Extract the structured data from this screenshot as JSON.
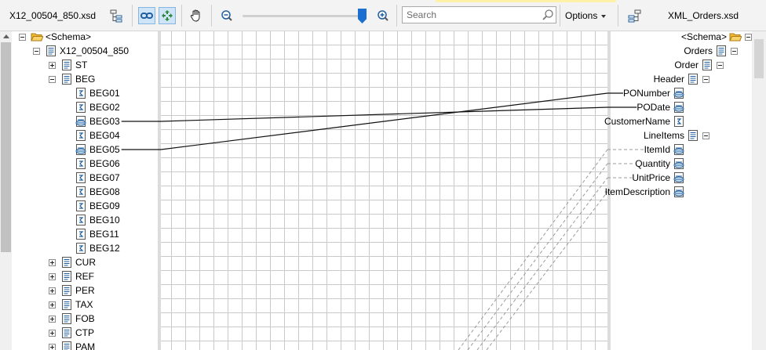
{
  "toolbar": {
    "source_schema_title": "X12_00504_850.xsd",
    "destination_schema_title": "XML_Orders.xsd",
    "search_placeholder": "Search",
    "options_label": "Options",
    "zoom_level": 0.95
  },
  "source_tree": [
    {
      "label": "<Schema>",
      "icon": "folder-open-icon",
      "depth": 0,
      "expander": "minus",
      "name": "source-schema-root"
    },
    {
      "label": "X12_00504_850",
      "icon": "document-icon",
      "depth": 1,
      "expander": "minus",
      "name": "source-record-x12-00504-850"
    },
    {
      "label": "ST",
      "icon": "document-icon",
      "depth": 2,
      "expander": "plus",
      "name": "source-record-st"
    },
    {
      "label": "BEG",
      "icon": "document-icon",
      "depth": 2,
      "expander": "minus",
      "name": "source-record-beg"
    },
    {
      "label": "BEG01",
      "icon": "field-icon",
      "depth": 3,
      "name": "source-field-beg01"
    },
    {
      "label": "BEG02",
      "icon": "field-icon",
      "depth": 3,
      "name": "source-field-beg02"
    },
    {
      "label": "BEG03",
      "icon": "linked-field-icon",
      "depth": 3,
      "name": "source-field-beg03",
      "linked": true
    },
    {
      "label": "BEG04",
      "icon": "field-icon",
      "depth": 3,
      "name": "source-field-beg04"
    },
    {
      "label": "BEG05",
      "icon": "linked-field-icon",
      "depth": 3,
      "name": "source-field-beg05",
      "linked": true
    },
    {
      "label": "BEG06",
      "icon": "field-icon",
      "depth": 3,
      "name": "source-field-beg06"
    },
    {
      "label": "BEG07",
      "icon": "field-icon",
      "depth": 3,
      "name": "source-field-beg07"
    },
    {
      "label": "BEG08",
      "icon": "field-icon",
      "depth": 3,
      "name": "source-field-beg08"
    },
    {
      "label": "BEG09",
      "icon": "field-icon",
      "depth": 3,
      "name": "source-field-beg09"
    },
    {
      "label": "BEG10",
      "icon": "field-icon",
      "depth": 3,
      "name": "source-field-beg10"
    },
    {
      "label": "BEG11",
      "icon": "field-icon",
      "depth": 3,
      "name": "source-field-beg11"
    },
    {
      "label": "BEG12",
      "icon": "field-icon",
      "depth": 3,
      "name": "source-field-beg12"
    },
    {
      "label": "CUR",
      "icon": "document-icon",
      "depth": 2,
      "expander": "plus",
      "name": "source-record-cur"
    },
    {
      "label": "REF",
      "icon": "document-icon",
      "depth": 2,
      "expander": "plus",
      "name": "source-record-ref"
    },
    {
      "label": "PER",
      "icon": "document-icon",
      "depth": 2,
      "expander": "plus",
      "name": "source-record-per"
    },
    {
      "label": "TAX",
      "icon": "document-icon",
      "depth": 2,
      "expander": "plus",
      "name": "source-record-tax"
    },
    {
      "label": "FOB",
      "icon": "document-icon",
      "depth": 2,
      "expander": "plus",
      "name": "source-record-fob"
    },
    {
      "label": "CTP",
      "icon": "document-icon",
      "depth": 2,
      "expander": "plus",
      "name": "source-record-ctp"
    },
    {
      "label": "PAM",
      "icon": "document-icon",
      "depth": 2,
      "expander": "plus",
      "name": "source-record-pam"
    }
  ],
  "destination_tree": [
    {
      "label": "<Schema>",
      "icon": "folder-open-icon",
      "depth": 0,
      "expander": "minus",
      "name": "dest-schema-root"
    },
    {
      "label": "Orders",
      "icon": "document-icon",
      "depth": 1,
      "expander": "minus",
      "name": "dest-record-orders"
    },
    {
      "label": "Order",
      "icon": "document-icon",
      "depth": 2,
      "expander": "minus",
      "name": "dest-record-order"
    },
    {
      "label": "Header",
      "icon": "document-icon",
      "depth": 3,
      "expander": "minus",
      "name": "dest-record-header"
    },
    {
      "label": "PONumber",
      "icon": "linked-field-icon",
      "depth": 4,
      "name": "dest-field-ponumber",
      "linked": true
    },
    {
      "label": "PODate",
      "icon": "linked-field-icon",
      "depth": 4,
      "name": "dest-field-podate",
      "linked": true
    },
    {
      "label": "CustomerName",
      "icon": "field-icon",
      "depth": 4,
      "name": "dest-field-customername"
    },
    {
      "label": "LineItems",
      "icon": "document-icon",
      "depth": 3,
      "expander": "minus",
      "name": "dest-record-lineitems"
    },
    {
      "label": "ItemId",
      "icon": "linked-field-icon",
      "depth": 4,
      "name": "dest-field-itemid",
      "linked": true
    },
    {
      "label": "Quantity",
      "icon": "linked-field-icon",
      "depth": 4,
      "name": "dest-field-quantity",
      "linked": true
    },
    {
      "label": "UnitPrice",
      "icon": "linked-field-icon",
      "depth": 4,
      "name": "dest-field-unitprice",
      "linked": true
    },
    {
      "label": "ItemDescription",
      "icon": "linked-field-icon",
      "depth": 4,
      "name": "dest-field-itemdescription",
      "linked": true
    }
  ],
  "links": [
    {
      "from": "BEG03",
      "to": "PODate",
      "style": "solid"
    },
    {
      "from": "BEG05",
      "to": "PONumber",
      "style": "solid"
    },
    {
      "from": "offscreen",
      "to": "ItemId",
      "style": "dashed"
    },
    {
      "from": "offscreen",
      "to": "Quantity",
      "style": "dashed"
    },
    {
      "from": "offscreen",
      "to": "UnitPrice",
      "style": "dashed"
    },
    {
      "from": "offscreen",
      "to": "ItemDescription",
      "style": "dashed"
    }
  ],
  "colors": {
    "accent": "#1c6fd1",
    "active_button": "#cfe4f7",
    "grid_line": "#c9c9c9",
    "folder": "#f0b93a",
    "icon_blue": "#1f5f9f"
  }
}
